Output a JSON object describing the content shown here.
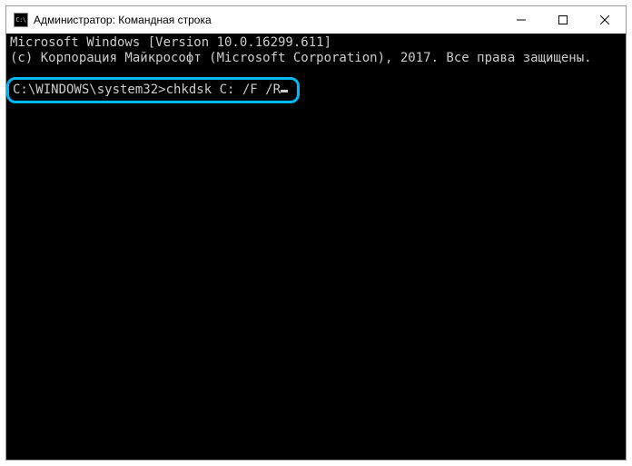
{
  "titlebar": {
    "icon_text": "C:\\",
    "title": "Администратор: Командная строка"
  },
  "terminal": {
    "line1": "Microsoft Windows [Version 10.0.16299.611]",
    "line2": "(c) Корпорация Майкрософт (Microsoft Corporation), 2017. Все права защищены.",
    "prompt": "C:\\WINDOWS\\system32>",
    "command": "chkdsk C: /F /R"
  }
}
